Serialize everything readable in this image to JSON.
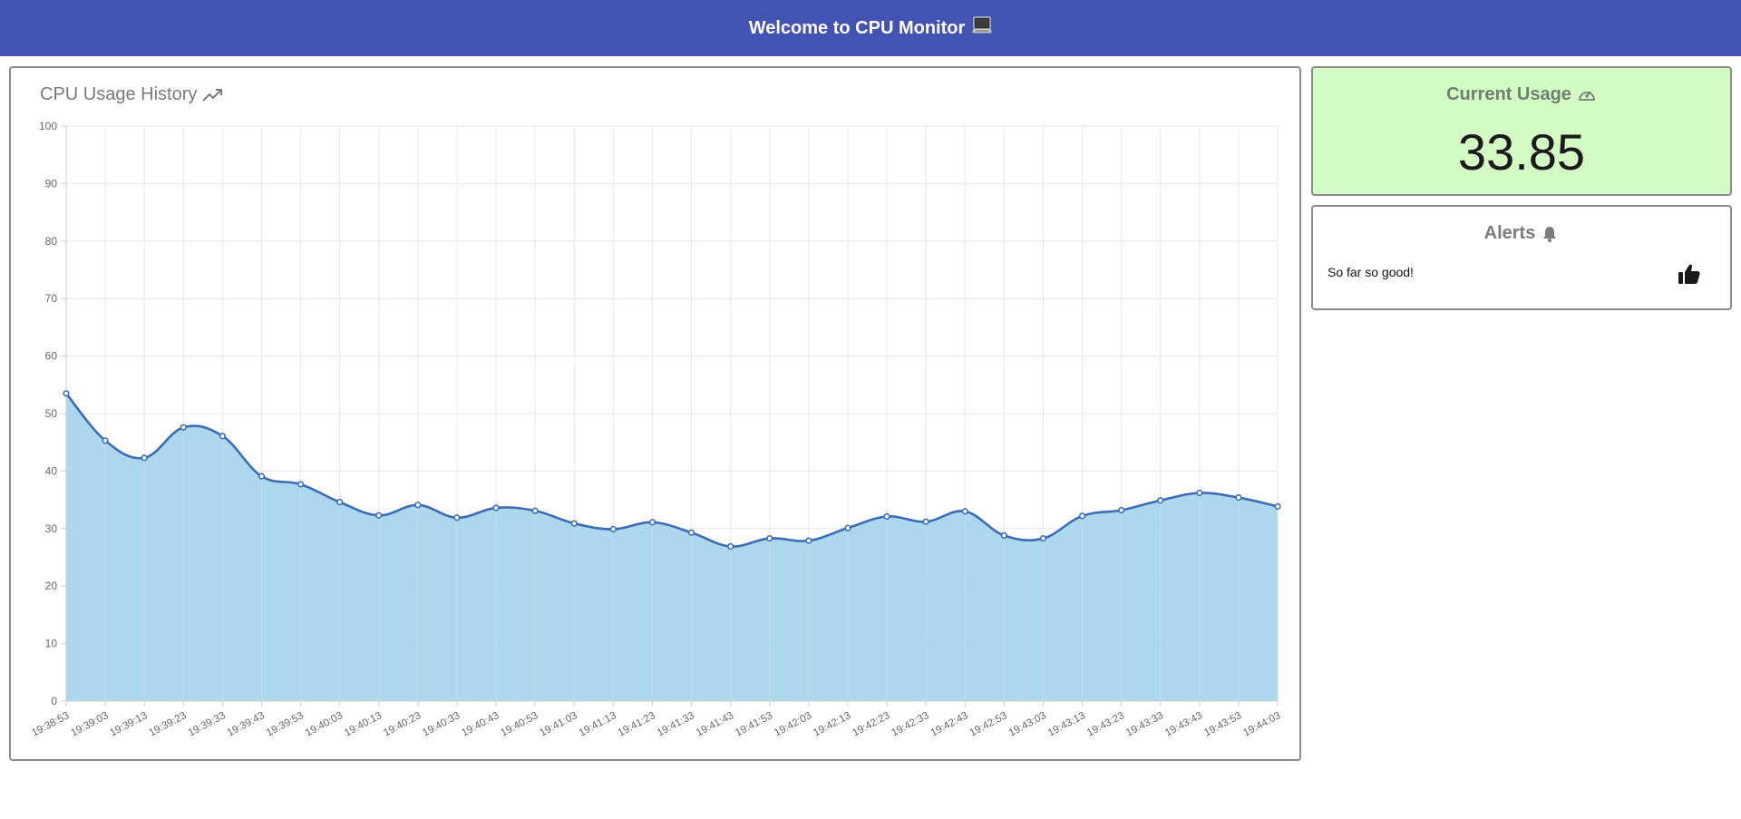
{
  "header": {
    "title": "Welcome to CPU Monitor"
  },
  "history_panel": {
    "title": "CPU Usage History"
  },
  "usage_panel": {
    "title": "Current Usage",
    "value": "33.85"
  },
  "alerts_panel": {
    "title": "Alerts",
    "message": "So far so good!"
  },
  "icons": {
    "header": "laptop-icon",
    "history": "trending-up-icon",
    "usage": "gauge-icon",
    "alerts": "bell-icon",
    "status": "thumbs-up-icon"
  },
  "colors": {
    "header_bg": "#4253b2",
    "usage_bg": "#d3fcc5",
    "line": "#3b6cb5",
    "fill": "#a8d5ec"
  },
  "chart_data": {
    "type": "area",
    "title": "CPU Usage History",
    "xlabel": "",
    "ylabel": "",
    "ylim": [
      0,
      100
    ],
    "yticks": [
      0,
      10,
      20,
      30,
      40,
      50,
      60,
      70,
      80,
      90,
      100
    ],
    "grid": true,
    "legend": "none",
    "x": [
      "19:38:53",
      "19:39:03",
      "19:39:13",
      "19:39:23",
      "19:39:33",
      "19:39:43",
      "19:39:53",
      "19:40:03",
      "19:40:13",
      "19:40:23",
      "19:40:33",
      "19:40:43",
      "19:40:53",
      "19:41:03",
      "19:41:13",
      "19:41:23",
      "19:41:33",
      "19:41:43",
      "19:41:53",
      "19:42:03",
      "19:42:13",
      "19:42:23",
      "19:42:33",
      "19:42:43",
      "19:42:53",
      "19:43:03",
      "19:43:13",
      "19:43:23",
      "19:43:33",
      "19:43:43",
      "19:43:53",
      "19:44:03"
    ],
    "series": [
      {
        "values": [
          53.5,
          45.3,
          42.3,
          47.6,
          46.1,
          39.1,
          37.7,
          34.6,
          32.3,
          34.1,
          31.9,
          33.6,
          33.1,
          30.9,
          29.9,
          31.1,
          29.3,
          26.9,
          28.3,
          27.9,
          30.1,
          32.1,
          31.2,
          33.0,
          28.8,
          28.3,
          32.2,
          33.2,
          34.9,
          36.2,
          35.4,
          33.85
        ]
      }
    ]
  }
}
